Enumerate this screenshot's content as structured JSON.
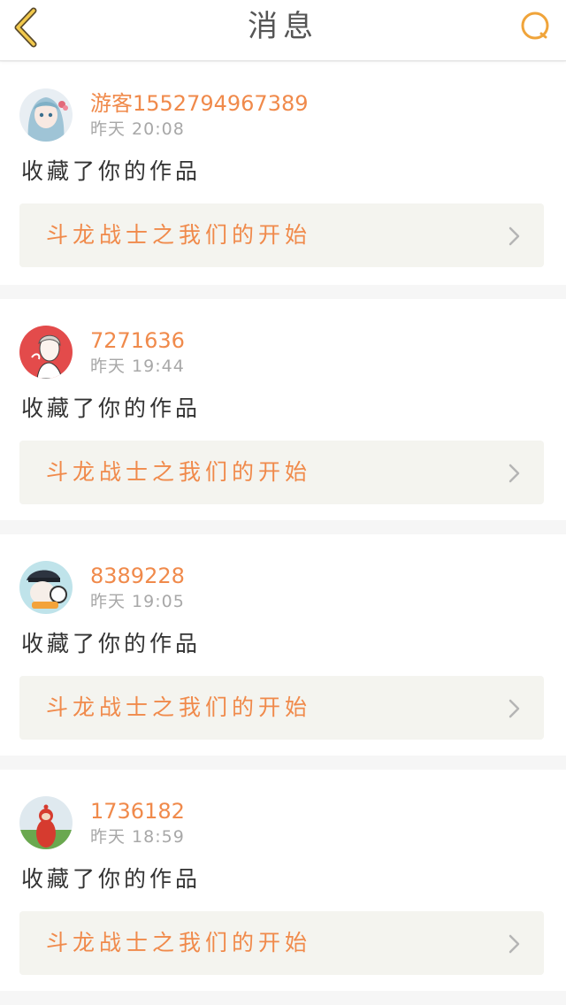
{
  "header": {
    "title": "消息",
    "back_icon": "chevron-left-icon",
    "search_icon": "search-icon",
    "accent_color": "#f0a43a"
  },
  "messages": [
    {
      "username": "游客1552794967389",
      "time": "昨天 20:08",
      "action": "收藏了你的作品",
      "work_title": "斗龙战士之我们的开始",
      "avatar": "anime-girl-avatar"
    },
    {
      "username": "7271636",
      "time": "昨天 19:44",
      "action": "收藏了你的作品",
      "work_title": "斗龙战士之我们的开始",
      "avatar": "sketch-boy-avatar"
    },
    {
      "username": "8389228",
      "time": "昨天 19:05",
      "action": "收藏了你的作品",
      "work_title": "斗龙战士之我们的开始",
      "avatar": "police-cap-avatar"
    },
    {
      "username": "1736182",
      "time": "昨天 18:59",
      "action": "收藏了你的作品",
      "work_title": "斗龙战士之我们的开始",
      "avatar": "teletubby-avatar"
    }
  ],
  "colors": {
    "username": "#f08a4b",
    "time": "#a8a8a8",
    "link_background": "#f4f4ef"
  }
}
